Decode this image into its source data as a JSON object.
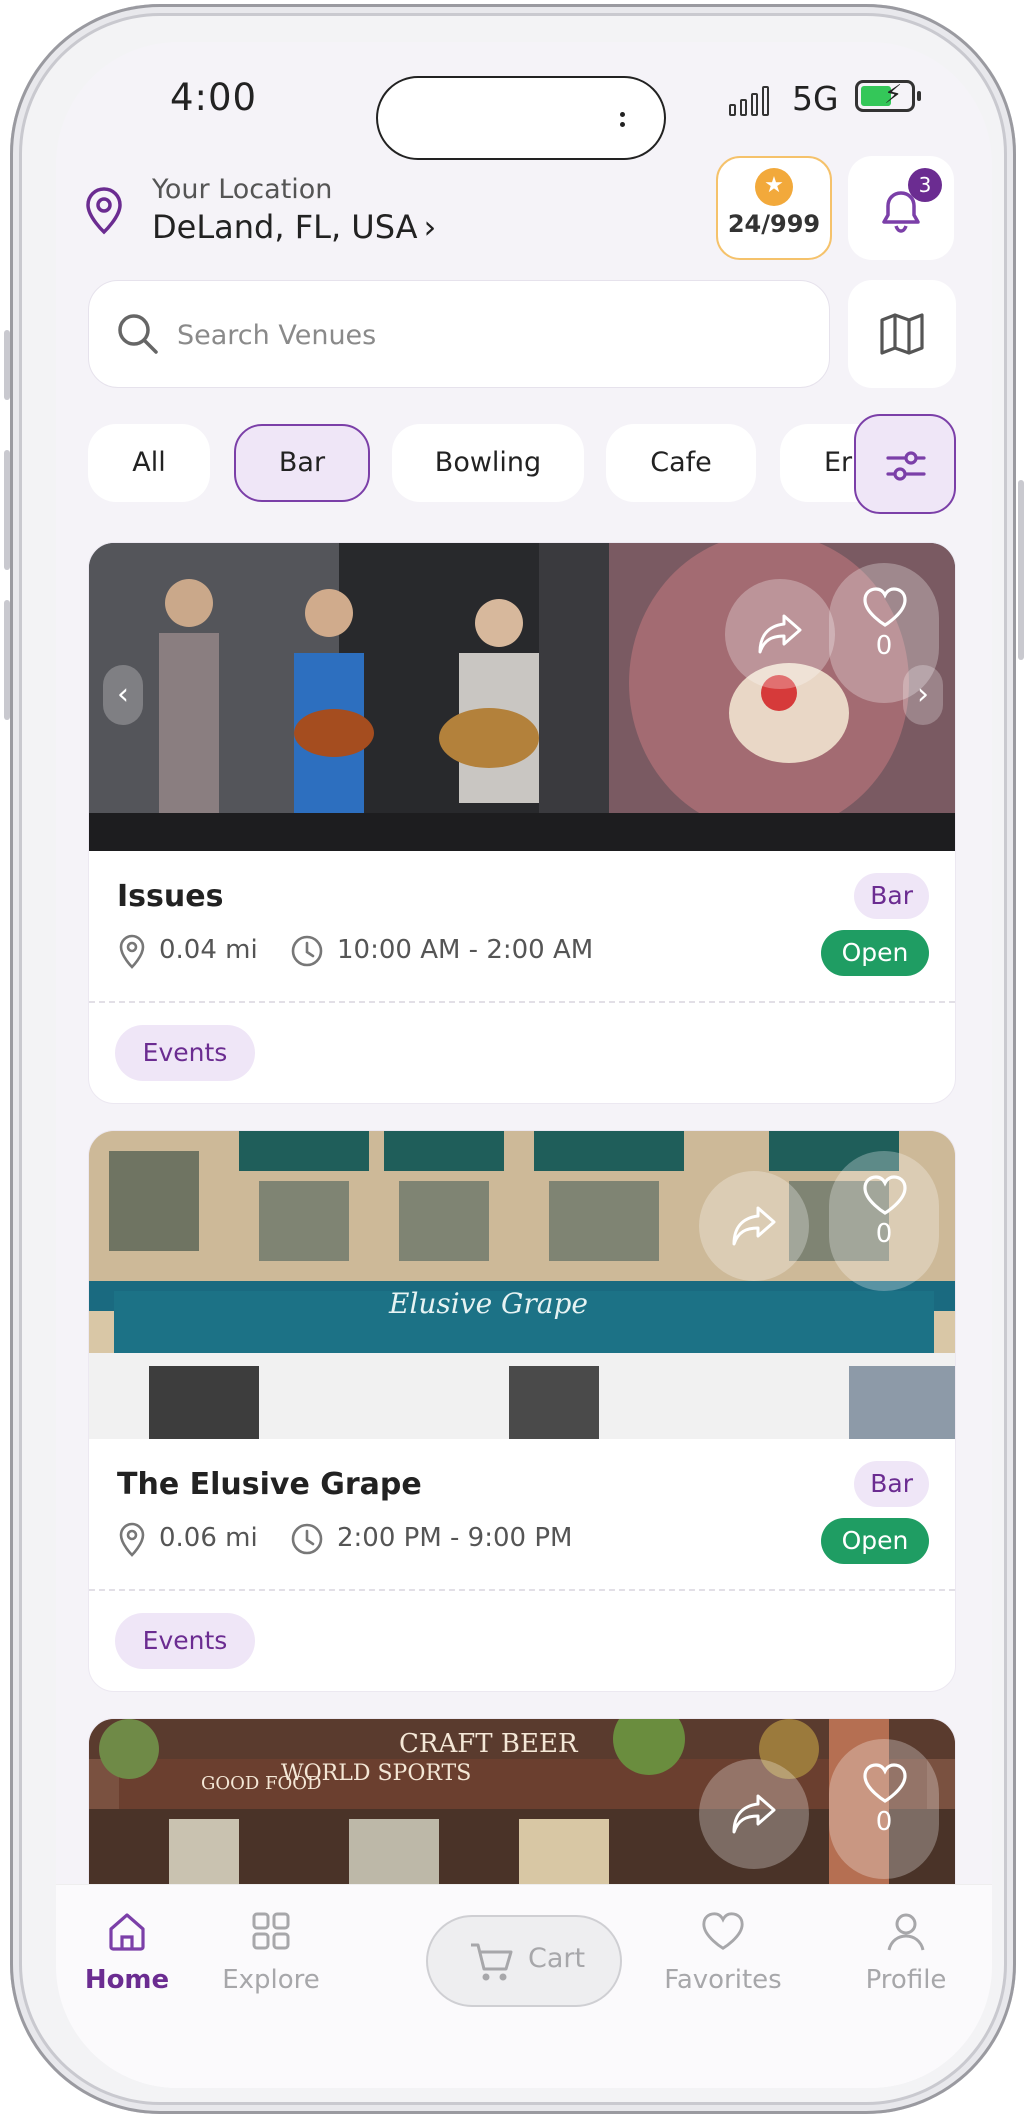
{
  "status_bar": {
    "time": "4:00",
    "network": "5G"
  },
  "location": {
    "label": "Your Location",
    "value": "DeLand, FL, USA",
    "chevron": "›"
  },
  "coins": {
    "value": "24/999",
    "icon": "coin-star-icon"
  },
  "notifications": {
    "count": "3",
    "icon": "bell-icon"
  },
  "search": {
    "placeholder": "Search Venues",
    "value": ""
  },
  "categories": [
    {
      "label": "All",
      "selected": false
    },
    {
      "label": "Bar",
      "selected": true
    },
    {
      "label": "Bowling",
      "selected": false
    },
    {
      "label": "Cafe",
      "selected": false
    },
    {
      "label": "Er",
      "selected": false
    }
  ],
  "venues": [
    {
      "name": "Issues",
      "category": "Bar",
      "distance": "0.04 mi",
      "hours": "10:00 AM - 2:00 AM",
      "status": "Open",
      "tag": "Events",
      "favorites": "0"
    },
    {
      "name": "The Elusive Grape",
      "category": "Bar",
      "distance": "0.06 mi",
      "hours": "2:00 PM - 9:00 PM",
      "status": "Open",
      "tag": "Events",
      "favorites": "0",
      "sign_text": "Elusive Grape"
    },
    {
      "name": "",
      "favorites": "0",
      "sign_texts": [
        "GOOD FOOD",
        "WORLD SPORTS",
        "CRAFT BEER"
      ]
    }
  ],
  "bottom_nav": {
    "home": "Home",
    "explore": "Explore",
    "cart": "Cart",
    "favorites": "Favorites",
    "profile": "Profile"
  },
  "colors": {
    "accent": "#6b2c91",
    "open": "#1f9d63",
    "coin_border": "#f5c26b"
  }
}
